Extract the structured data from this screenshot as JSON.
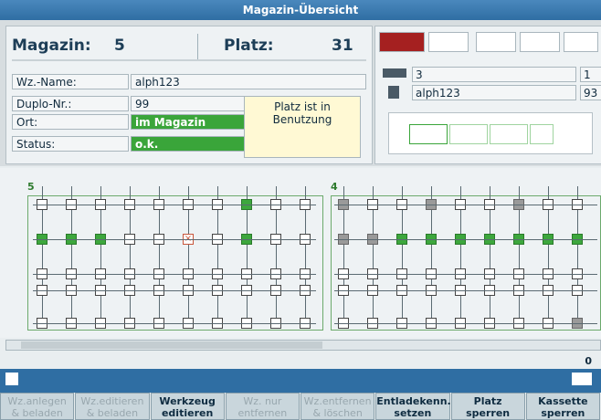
{
  "window": {
    "title": "Magazin-Übersicht"
  },
  "header": {
    "magazin_label": "Magazin:",
    "magazin_value": "5",
    "platz_label": "Platz:",
    "platz_value": "31"
  },
  "fields": [
    {
      "label": "Wz.-Name:",
      "value": "alph123"
    },
    {
      "label": "Duplo-Nr.:",
      "value": "99"
    },
    {
      "label": "Ort:",
      "value": "im Magazin"
    },
    {
      "label": "Status:",
      "value": "o.k."
    }
  ],
  "notice": "Platz ist in Benutzung",
  "right_panel": {
    "rows": [
      {
        "icon": "tool-icon",
        "text": "3",
        "value": "1"
      },
      {
        "icon": "tool-holder-icon",
        "text": "alph123",
        "value": "93"
      }
    ]
  },
  "grid": {
    "magazine_left": "5",
    "magazine_right": "4"
  },
  "status_bar": {
    "value": "0"
  },
  "softkeys": [
    {
      "label": "Wz.anlegen\n& beladen",
      "enabled": false
    },
    {
      "label": "Wz.editieren\n& beladen",
      "enabled": false
    },
    {
      "label": "Werkzeug\neditieren",
      "enabled": true
    },
    {
      "label": "Wz. nur\nentfernen",
      "enabled": false
    },
    {
      "label": "Wz.entfernen\n& löschen",
      "enabled": false
    },
    {
      "label": "Entladekenn.\nsetzen",
      "enabled": true
    },
    {
      "label": "Platz\nsperren",
      "enabled": true
    },
    {
      "label": "Kassette\nsperren",
      "enabled": true
    }
  ],
  "colors": {
    "titlebar": "#2f6ea3",
    "occupied": "#3da73d",
    "blocked": "#9a9a9a"
  }
}
